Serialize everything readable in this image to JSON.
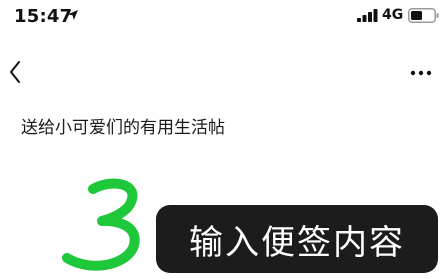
{
  "status_bar": {
    "time": "15:47",
    "network": "4G",
    "icons": [
      "location-arrow-icon",
      "signal-bars-icon",
      "battery-icon"
    ]
  },
  "nav": {
    "back_icon": "chevron-left-icon",
    "more_icon": "ellipsis-icon"
  },
  "post": {
    "title": "送给小可爱们的有用生活帖"
  },
  "step": {
    "number": "3",
    "caption": "输入便签内容"
  },
  "colors": {
    "step_number": "#1fc83a",
    "caption_background": "#1c1c1c",
    "caption_text": "#ffffff"
  }
}
